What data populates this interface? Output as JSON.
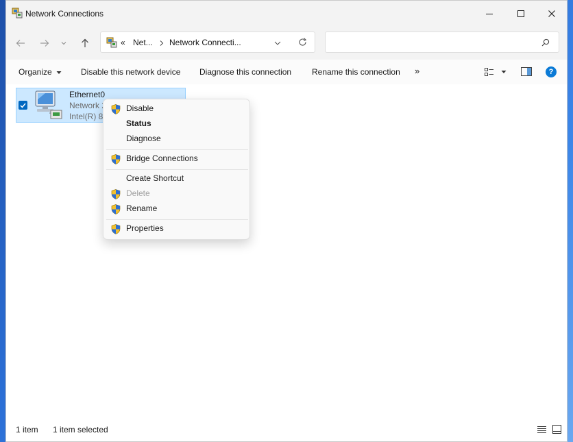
{
  "window": {
    "title": "Network Connections"
  },
  "address": {
    "overflow": "«",
    "segment1": "Net...",
    "segment2": "Network Connecti...",
    "search_placeholder": ""
  },
  "toolbar": {
    "organize": "Organize",
    "disable": "Disable this network device",
    "diagnose": "Diagnose this connection",
    "rename": "Rename this connection",
    "more": "»"
  },
  "item": {
    "name": "Ethernet0",
    "line2": "Network 2",
    "line3": "Intel(R) 82574L"
  },
  "context_menu": {
    "disable": "Disable",
    "status": "Status",
    "diagnose": "Diagnose",
    "bridge": "Bridge Connections",
    "create_shortcut": "Create Shortcut",
    "delete": "Delete",
    "rename": "Rename",
    "properties": "Properties"
  },
  "status": {
    "count": "1 item",
    "selected": "1 item selected"
  },
  "colors": {
    "accent": "#0067c0",
    "selection": "#cce8ff",
    "help": "#0a7ad6"
  }
}
